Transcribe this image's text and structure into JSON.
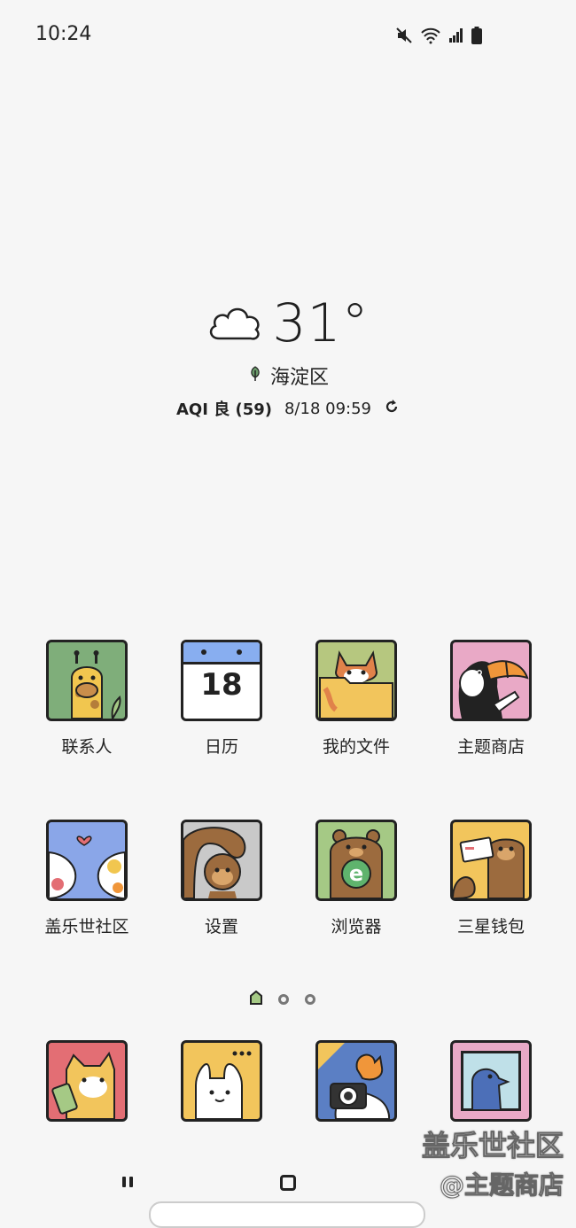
{
  "status_bar": {
    "time": "10:24",
    "icons": [
      "mute-icon",
      "wifi-icon",
      "signal-icon",
      "battery-icon"
    ]
  },
  "weather": {
    "icon": "cloud-icon",
    "temperature": "31°",
    "location": "海淀区",
    "aqi_label": "AQI 良 (59)",
    "updated": "8/18 09:59",
    "refresh_icon": "refresh-icon"
  },
  "apps_row1": [
    {
      "label": "联系人",
      "icon": "giraffe-icon"
    },
    {
      "label": "日历",
      "icon": "calendar-icon",
      "day": "18"
    },
    {
      "label": "我的文件",
      "icon": "fox-folder-icon"
    },
    {
      "label": "主题商店",
      "icon": "toucan-icon"
    }
  ],
  "apps_row2": [
    {
      "label": "盖乐世社区",
      "icon": "two-cats-heart-icon"
    },
    {
      "label": "设置",
      "icon": "monkey-icon"
    },
    {
      "label": "浏览器",
      "icon": "bear-browser-icon"
    },
    {
      "label": "三星钱包",
      "icon": "squirrel-card-icon"
    }
  ],
  "dock": [
    {
      "icon": "cat-phone-icon"
    },
    {
      "icon": "rabbit-message-icon"
    },
    {
      "icon": "chicken-camera-icon"
    },
    {
      "icon": "penguin-gallery-icon"
    }
  ],
  "page_indicator": {
    "count": 3,
    "active": 0
  },
  "watermark": {
    "line1": "盖乐世社区",
    "line2": "@主题商店"
  },
  "colors": {
    "background": "#f6f6f6",
    "outline": "#222222"
  }
}
